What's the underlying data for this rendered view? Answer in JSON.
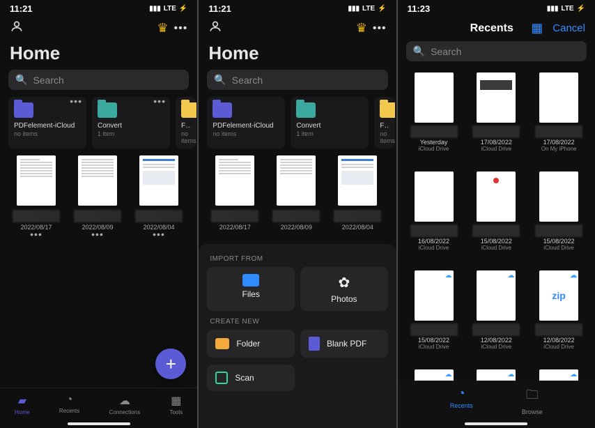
{
  "status": {
    "time1": "11:21",
    "time2": "11:21",
    "time3": "11:23",
    "net": "LTE",
    "battery": "⚡"
  },
  "home": {
    "title": "Home",
    "search_placeholder": "Search",
    "folders": [
      {
        "name": "PDFelement-iCloud",
        "sub": "no items",
        "color": "purple"
      },
      {
        "name": "Convert",
        "sub": "1 item",
        "color": "teal"
      },
      {
        "name": "Favori",
        "sub": "no items",
        "color": "yellow"
      }
    ],
    "files": [
      {
        "date": "2022/08/17"
      },
      {
        "date": "2022/08/09"
      },
      {
        "date": "2022/08/04"
      }
    ],
    "tabs": {
      "home": "Home",
      "recents": "Recents",
      "connections": "Connections",
      "tools": "Tools"
    }
  },
  "sheet": {
    "import_label": "IMPORT FROM",
    "files": "Files",
    "photos": "Photos",
    "create_label": "CREATE NEW",
    "folder": "Folder",
    "blank_pdf": "Blank PDF",
    "scan": "Scan"
  },
  "picker": {
    "title": "Recents",
    "cancel": "Cancel",
    "search_placeholder": "Search",
    "items": [
      {
        "date": "Yesterday",
        "loc": "iCloud Drive"
      },
      {
        "date": "17/08/2022",
        "loc": "iCloud Drive"
      },
      {
        "date": "17/08/2022",
        "loc": "On My iPhone"
      },
      {
        "date": "16/08/2022",
        "loc": "iCloud Drive"
      },
      {
        "date": "15/08/2022",
        "loc": "iCloud Drive"
      },
      {
        "date": "15/08/2022",
        "loc": "iCloud Drive"
      },
      {
        "date": "15/08/2022",
        "loc": "iCloud Drive"
      },
      {
        "date": "12/08/2022",
        "loc": "iCloud Drive"
      },
      {
        "date": "12/08/2022",
        "loc": "iCloud Drive",
        "zip": true
      }
    ],
    "tabs": {
      "recents": "Recents",
      "browse": "Browse"
    }
  }
}
